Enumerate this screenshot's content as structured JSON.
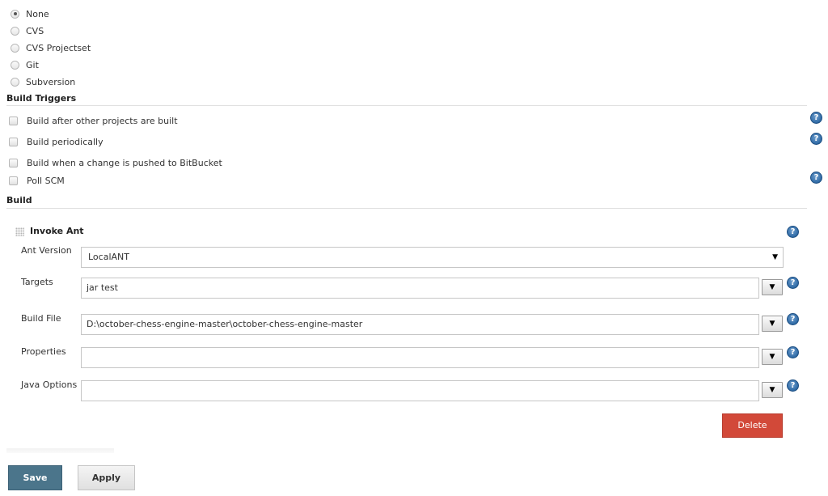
{
  "scm": {
    "options": [
      {
        "label": "None",
        "checked": true
      },
      {
        "label": "CVS",
        "checked": false
      },
      {
        "label": "CVS Projectset",
        "checked": false
      },
      {
        "label": "Git",
        "checked": false
      },
      {
        "label": "Subversion",
        "checked": false
      }
    ]
  },
  "build_triggers": {
    "title": "Build Triggers",
    "items": [
      {
        "label": "Build after other projects are built",
        "checked": false
      },
      {
        "label": "Build periodically",
        "checked": false
      },
      {
        "label": "Build when a change is pushed to BitBucket",
        "checked": false
      },
      {
        "label": "Poll SCM",
        "checked": false
      }
    ]
  },
  "build": {
    "title": "Build",
    "step": {
      "title": "Invoke Ant",
      "ant_version_label": "Ant Version",
      "ant_version_value": "LocalANT",
      "targets_label": "Targets",
      "targets_value": "jar test",
      "build_file_label": "Build File",
      "build_file_value": "D:\\october-chess-engine-master\\october-chess-engine-master",
      "properties_label": "Properties",
      "properties_value": "",
      "java_options_label": "Java Options",
      "java_options_value": "",
      "delete_label": "Delete"
    }
  },
  "icons": {
    "help": "?",
    "dropdown_arrow": "▼"
  },
  "footer": {
    "save_label": "Save",
    "apply_label": "Apply"
  },
  "colors": {
    "delete_button": "#d24939",
    "save_button": "#4b758b",
    "help_icon": "#2f6aa5"
  }
}
